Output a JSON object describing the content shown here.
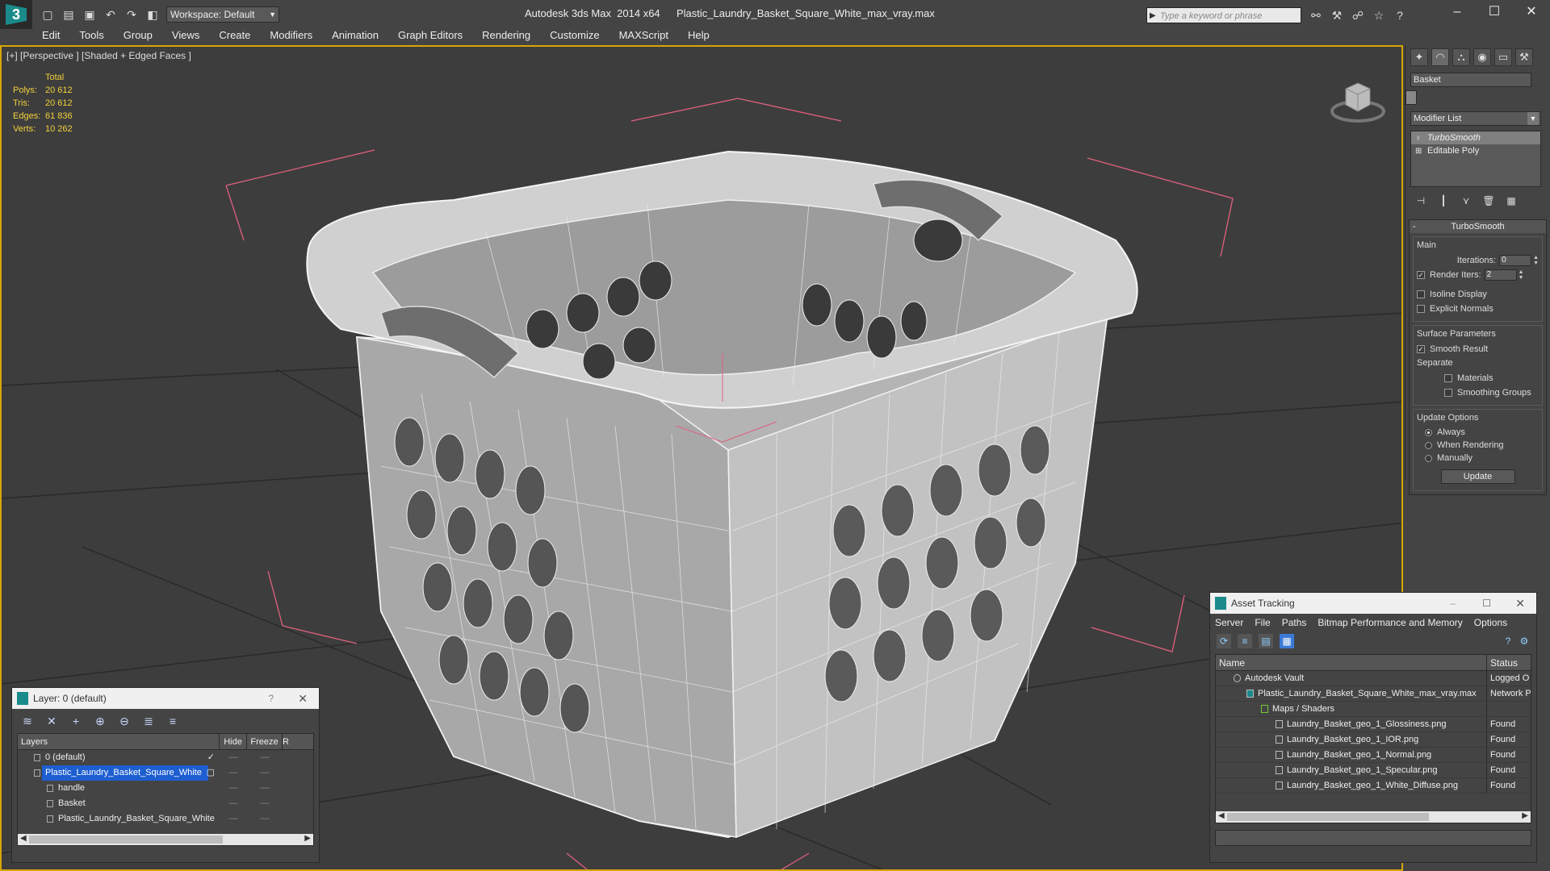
{
  "titlebar": {
    "app_title": "Autodesk 3ds Max  2014 x64",
    "file_name": "Plastic_Laundry_Basket_Square_White_max_vray.max",
    "workspace": "Workspace: Default",
    "search_placeholder": "Type a keyword or phrase"
  },
  "menu": [
    "Edit",
    "Tools",
    "Group",
    "Views",
    "Create",
    "Modifiers",
    "Animation",
    "Graph Editors",
    "Rendering",
    "Customize",
    "MAXScript",
    "Help"
  ],
  "viewport": {
    "label": "[+] [Perspective ] [Shaded + Edged Faces ]",
    "stats": {
      "header": "Total",
      "rows": [
        {
          "key": "Polys:",
          "value": "20 612"
        },
        {
          "key": "Tris:",
          "value": "20 612"
        },
        {
          "key": "Edges:",
          "value": "61 836"
        },
        {
          "key": "Verts:",
          "value": "10 262"
        }
      ]
    }
  },
  "command_panel": {
    "object_name": "Basket",
    "modifier_list": "Modifier List",
    "stack": [
      "TurboSmooth",
      "Editable Poly"
    ],
    "rollout_title": "TurboSmooth",
    "main_group": "Main",
    "iterations_label": "Iterations:",
    "iterations_value": "0",
    "render_iters_label": "Render Iters:",
    "render_iters_value": "2",
    "isoline_label": "Isoline Display",
    "explicit_normals_label": "Explicit Normals",
    "surface_group": "Surface Parameters",
    "smooth_result_label": "Smooth Result",
    "separate_label": "Separate",
    "materials_label": "Materials",
    "smoothing_groups_label": "Smoothing Groups",
    "update_group": "Update Options",
    "always_label": "Always",
    "when_rendering_label": "When Rendering",
    "manually_label": "Manually",
    "update_button": "Update"
  },
  "layer_dialog": {
    "title": "Layer: 0 (default)",
    "help": "?",
    "headers": {
      "layers": "Layers",
      "hide": "Hide",
      "freeze": "Freeze",
      "r": "R"
    },
    "rows": [
      {
        "name": "0 (default)"
      },
      {
        "name": "Plastic_Laundry_Basket_Square_White"
      },
      {
        "name": "handle"
      },
      {
        "name": "Basket"
      },
      {
        "name": "Plastic_Laundry_Basket_Square_White"
      }
    ]
  },
  "asset_dialog": {
    "title": "Asset Tracking",
    "menu": [
      "Server",
      "File",
      "Paths",
      "Bitmap Performance and Memory",
      "Options"
    ],
    "headers": {
      "name": "Name",
      "status": "Status"
    },
    "rows": [
      {
        "name": "Autodesk Vault",
        "status": "Logged O"
      },
      {
        "name": "Plastic_Laundry_Basket_Square_White_max_vray.max",
        "status": "Network P"
      },
      {
        "name": "Maps / Shaders",
        "status": ""
      },
      {
        "name": "Laundry_Basket_geo_1_Glossiness.png",
        "status": "Found"
      },
      {
        "name": "Laundry_Basket_geo_1_IOR.png",
        "status": "Found"
      },
      {
        "name": "Laundry_Basket_geo_1_Normal.png",
        "status": "Found"
      },
      {
        "name": "Laundry_Basket_geo_1_Specular.png",
        "status": "Found"
      },
      {
        "name": "Laundry_Basket_geo_1_White_Diffuse.png",
        "status": "Found"
      }
    ]
  },
  "colors": {
    "viewport_border": "#d7a600",
    "stats_text": "#f2d13b",
    "selection": "#1d5ed1",
    "bounding_box": "#e0607e"
  }
}
